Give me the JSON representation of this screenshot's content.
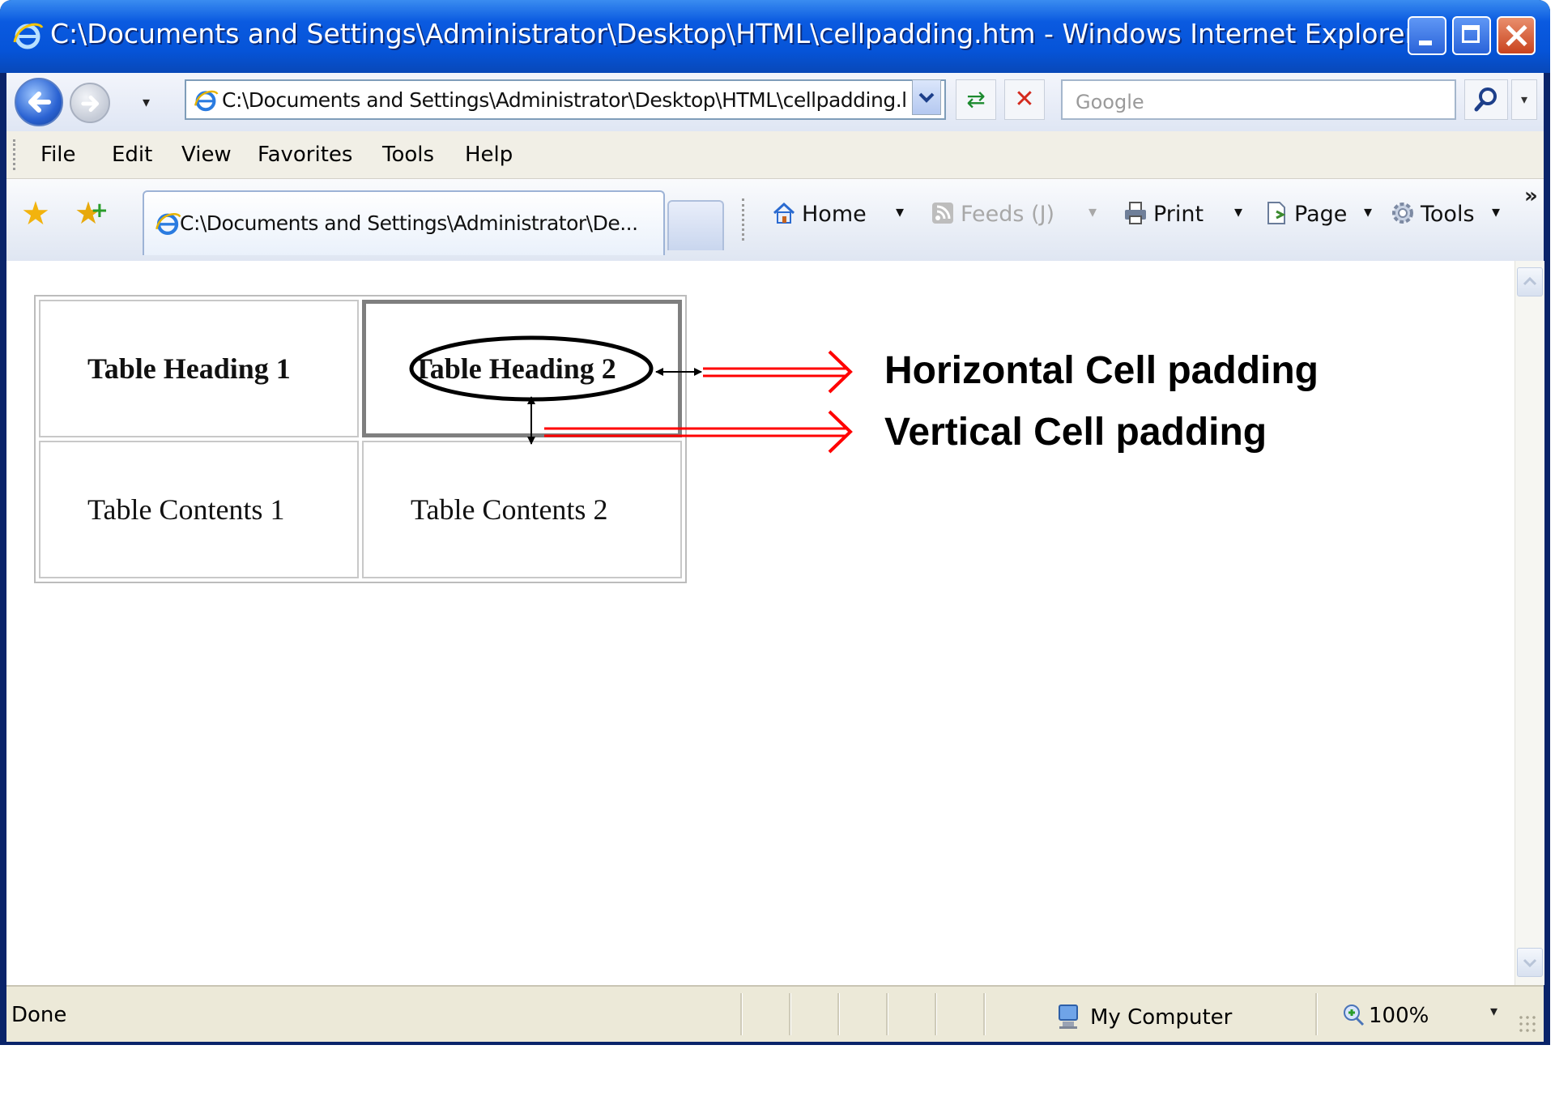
{
  "window": {
    "title": "C:\\Documents and Settings\\Administrator\\Desktop\\HTML\\cellpadding.htm - Windows Internet Explorer",
    "controls": [
      "minimize-icon",
      "maximize-icon",
      "close-icon"
    ]
  },
  "navbar": {
    "address": "C:\\Documents and Settings\\Administrator\\Desktop\\HTML\\cellpadding.l",
    "search_placeholder": "Google",
    "nav_dropdown": "▾",
    "addr_dropdown": "▾",
    "search_dropdown": "▾",
    "refresh_glyph": "⇄",
    "stop_glyph": "✕"
  },
  "menu": {
    "items": [
      "File",
      "Edit",
      "View",
      "Favorites",
      "Tools",
      "Help"
    ]
  },
  "tabs": {
    "active_label": "C:\\Documents and Settings\\Administrator\\De..."
  },
  "commandbar": {
    "home": "Home",
    "feeds": "Feeds (J)",
    "print": "Print",
    "page": "Page",
    "tools": "Tools",
    "dropdown": "▾",
    "overflow": "»"
  },
  "page": {
    "table": {
      "headers": [
        "Table Heading 1",
        "Table Heading 2"
      ],
      "rows": [
        [
          "Table Contents 1",
          "Table Contents 2"
        ]
      ]
    },
    "annotations": {
      "horizontal": "Horizontal Cell padding",
      "vertical": "Vertical Cell padding"
    },
    "colors": {
      "arrow": "#ff0000",
      "highlight_border": "#7f7f7f"
    }
  },
  "status": {
    "text": "Done",
    "zone": "My Computer",
    "zoom": "100%",
    "zoom_dropdown": "▾"
  }
}
